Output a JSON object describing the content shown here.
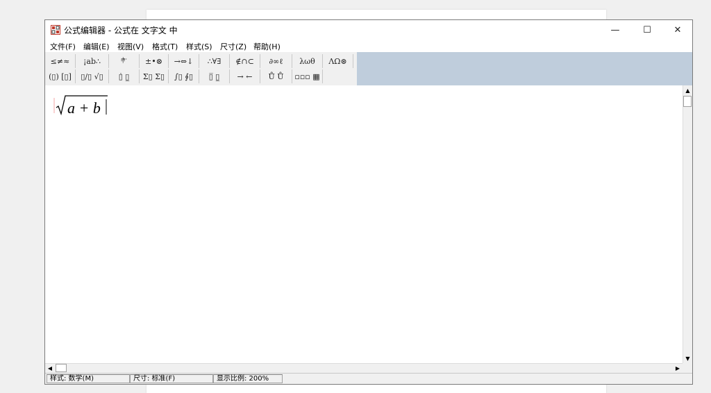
{
  "window": {
    "title": "公式编辑器 - 公式在 文字文 中",
    "minimize_glyph": "—",
    "maximize_glyph": "☐",
    "close_glyph": "✕"
  },
  "menu": [
    "文件(F)",
    "编辑(E)",
    "视图(V)",
    "格式(T)",
    "样式(S)",
    "尺寸(Z)",
    "帮助(H)"
  ],
  "palette_row1": [
    "≤≠≈",
    "¡ab∴",
    "⫩⃗ ⃛",
    "±•⊗",
    "→⇔↓",
    "∴∀∃",
    "∉∩⊂",
    "∂∞ℓ",
    "λωθ",
    "ΛΩ⊛"
  ],
  "palette_row2": [
    "(▯) [▯]",
    "▯/▯ √▯",
    "▯̇ ▯̲",
    "Σ▯ Σ▯",
    "∫▯ ∮▯",
    "▯̅ ▯̲",
    "→ ←",
    "Ů Ů",
    "▫▫▫ ▦"
  ],
  "equation": {
    "radical": "√",
    "expression": "a + b"
  },
  "scroll": {
    "up": "▲",
    "down": "▼",
    "left": "◀",
    "right": "▶"
  },
  "status": {
    "style": "样式: 数学(M)",
    "size": "尺寸: 标准(F)",
    "zoom": "显示比例: 200%"
  },
  "colors": {
    "toolbar_band": "#bfcddc",
    "icon_red": "#c0392b"
  },
  "icons": {
    "app": "equation-editor-icon"
  }
}
